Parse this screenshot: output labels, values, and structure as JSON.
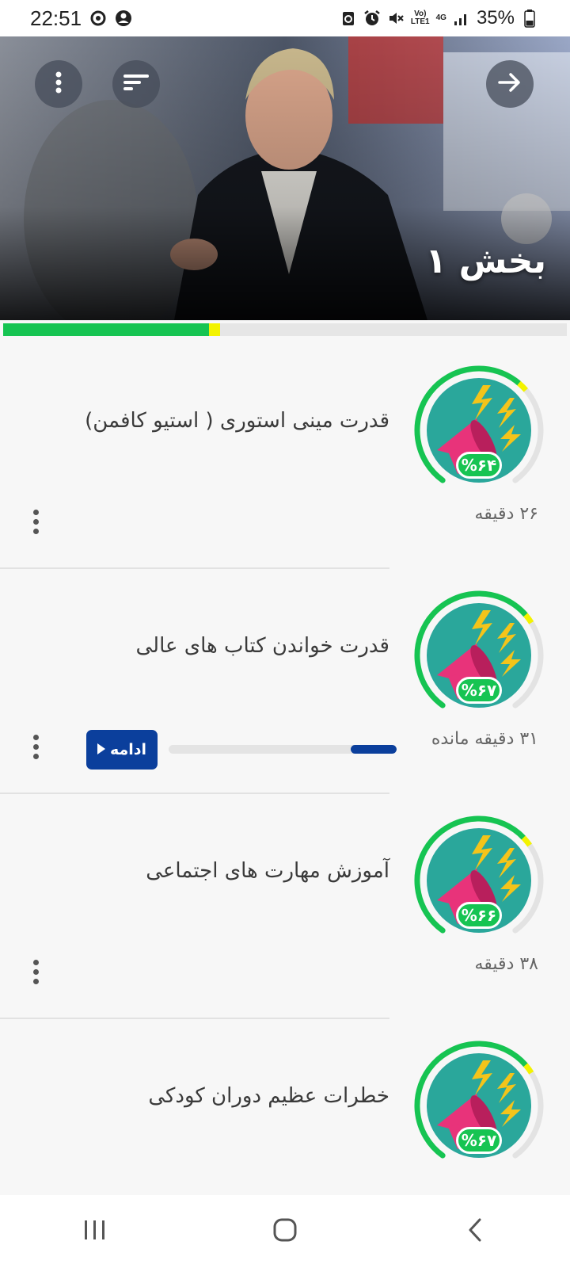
{
  "status_bar": {
    "time": "22:51",
    "network_top": "Vo)",
    "network_bottom": "LTE1",
    "network_type": "4G",
    "battery": "35%"
  },
  "hero": {
    "title": "بخش ۱",
    "menu_icon": "more-vertical-icon",
    "sort_icon": "sort-icon",
    "back_icon": "arrow-right-icon"
  },
  "section_progress": 0.365,
  "lessons": [
    {
      "title": "قدرت مینی استوری ( استیو کافمن)",
      "percent": "%۶۴",
      "duration": "۲۶ دقیقه",
      "ring_progress": 0.64
    },
    {
      "title": "قدرت خواندن کتاب های عالی",
      "percent": "%۶۷",
      "duration": "۳۱ دقیقه مانده",
      "ring_progress": 0.67,
      "listen_progress": 0.2,
      "continue_label": "ادامه"
    },
    {
      "title": "آموزش مهارت های اجتماعی",
      "percent": "%۶۶",
      "duration": "۳۸ دقیقه",
      "ring_progress": 0.66
    },
    {
      "title": "خطرات عظیم دوران کودکی",
      "percent": "%۶۷",
      "duration": "",
      "ring_progress": 0.67
    }
  ],
  "colors": {
    "accent_green": "#16c452",
    "accent_yellow": "#f3f300",
    "accent_blue": "#0b3f9c",
    "icon_teal": "#2aa79b",
    "megaphone_pink": "#e8337a"
  }
}
